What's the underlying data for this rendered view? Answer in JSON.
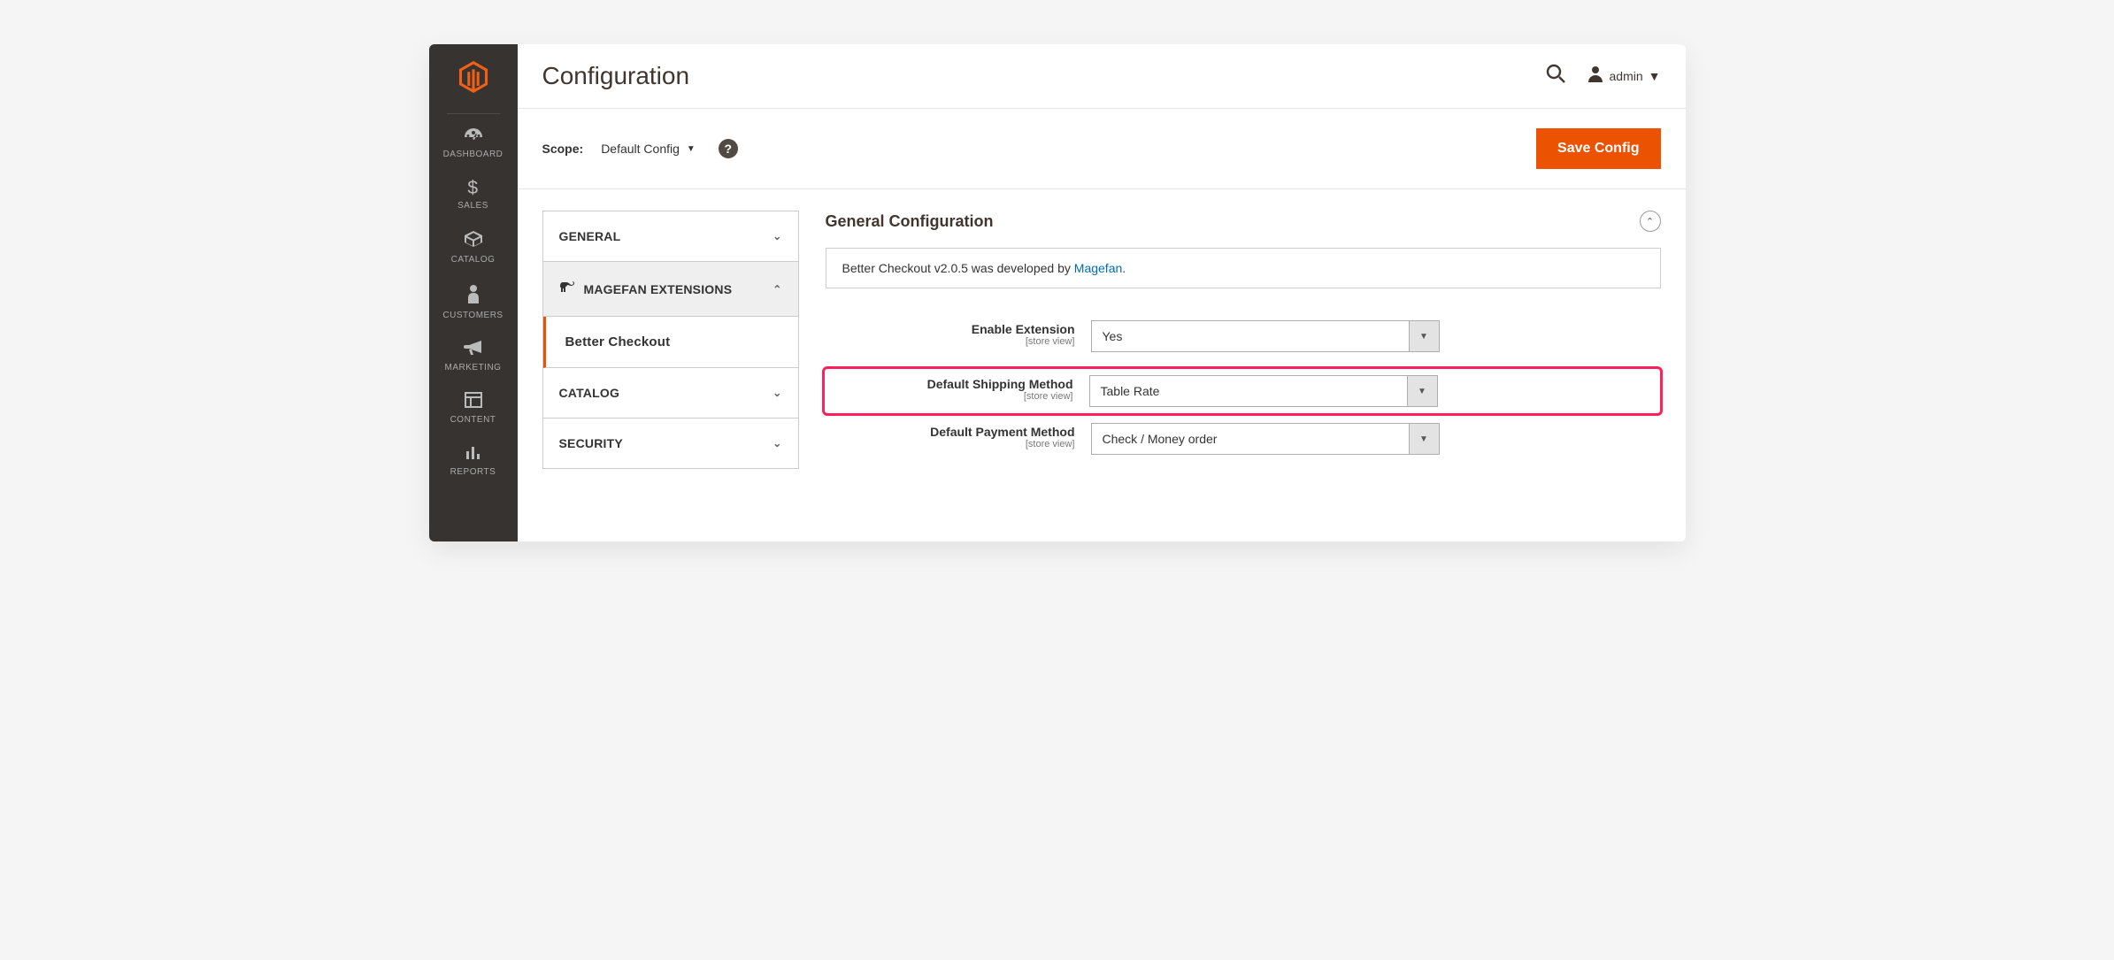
{
  "sidebar": {
    "items": [
      {
        "icon": "dash",
        "label": "DASHBOARD"
      },
      {
        "icon": "dollar",
        "label": "SALES"
      },
      {
        "icon": "box",
        "label": "CATALOG"
      },
      {
        "icon": "person",
        "label": "CUSTOMERS"
      },
      {
        "icon": "horn",
        "label": "MARKETING"
      },
      {
        "icon": "layout",
        "label": "CONTENT"
      },
      {
        "icon": "bars",
        "label": "REPORTS"
      }
    ]
  },
  "header": {
    "title": "Configuration",
    "user": "admin"
  },
  "toolbar": {
    "scope_label": "Scope:",
    "scope_value": "Default Config",
    "save_label": "Save Config"
  },
  "tabs": {
    "general": "GENERAL",
    "magefan": "MAGEFAN EXTENSIONS",
    "better_checkout": "Better Checkout",
    "catalog": "CATALOG",
    "security": "SECURITY"
  },
  "section": {
    "title": "General Configuration",
    "info_prefix": "Better Checkout v2.0.5 was developed by ",
    "info_link": "Magefan",
    "info_suffix": "."
  },
  "fields": {
    "enable": {
      "label": "Enable Extension",
      "scope": "[store view]",
      "value": "Yes"
    },
    "shipping": {
      "label": "Default Shipping Method",
      "scope": "[store view]",
      "value": "Table Rate"
    },
    "payment": {
      "label": "Default Payment Method",
      "scope": "[store view]",
      "value": "Check / Money order"
    }
  }
}
